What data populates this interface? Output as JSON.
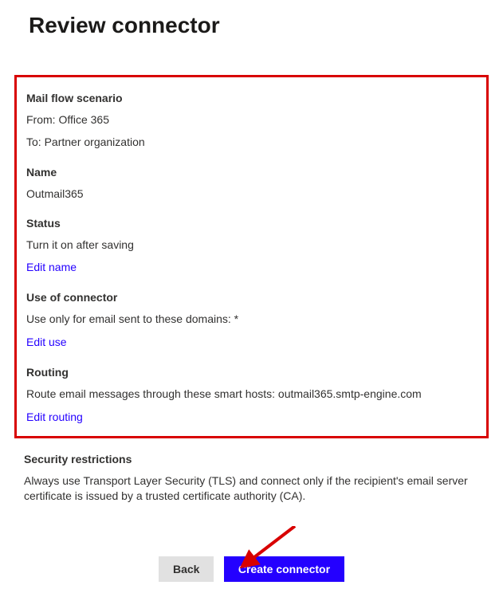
{
  "title": "Review connector",
  "sections": {
    "scenario": {
      "heading": "Mail flow scenario",
      "from_label": "From: Office 365",
      "to_label": "To: Partner organization"
    },
    "name": {
      "heading": "Name",
      "value": "Outmail365"
    },
    "status": {
      "heading": "Status",
      "value": "Turn it on after saving",
      "edit_link": "Edit name"
    },
    "use": {
      "heading": "Use of connector",
      "value": "Use only for email sent to these domains: *",
      "edit_link": "Edit use"
    },
    "routing": {
      "heading": "Routing",
      "value": "Route email messages through these smart hosts: outmail365.smtp-engine.com",
      "edit_link": "Edit routing"
    },
    "security": {
      "heading": "Security restrictions",
      "value": "Always use Transport Layer Security (TLS) and connect only if the recipient's email server certificate is issued by a trusted certificate authority (CA)."
    }
  },
  "buttons": {
    "back": "Back",
    "create": "Create connector"
  },
  "annotation": {
    "highlight_color": "#d80000",
    "arrow_color": "#d80000"
  }
}
